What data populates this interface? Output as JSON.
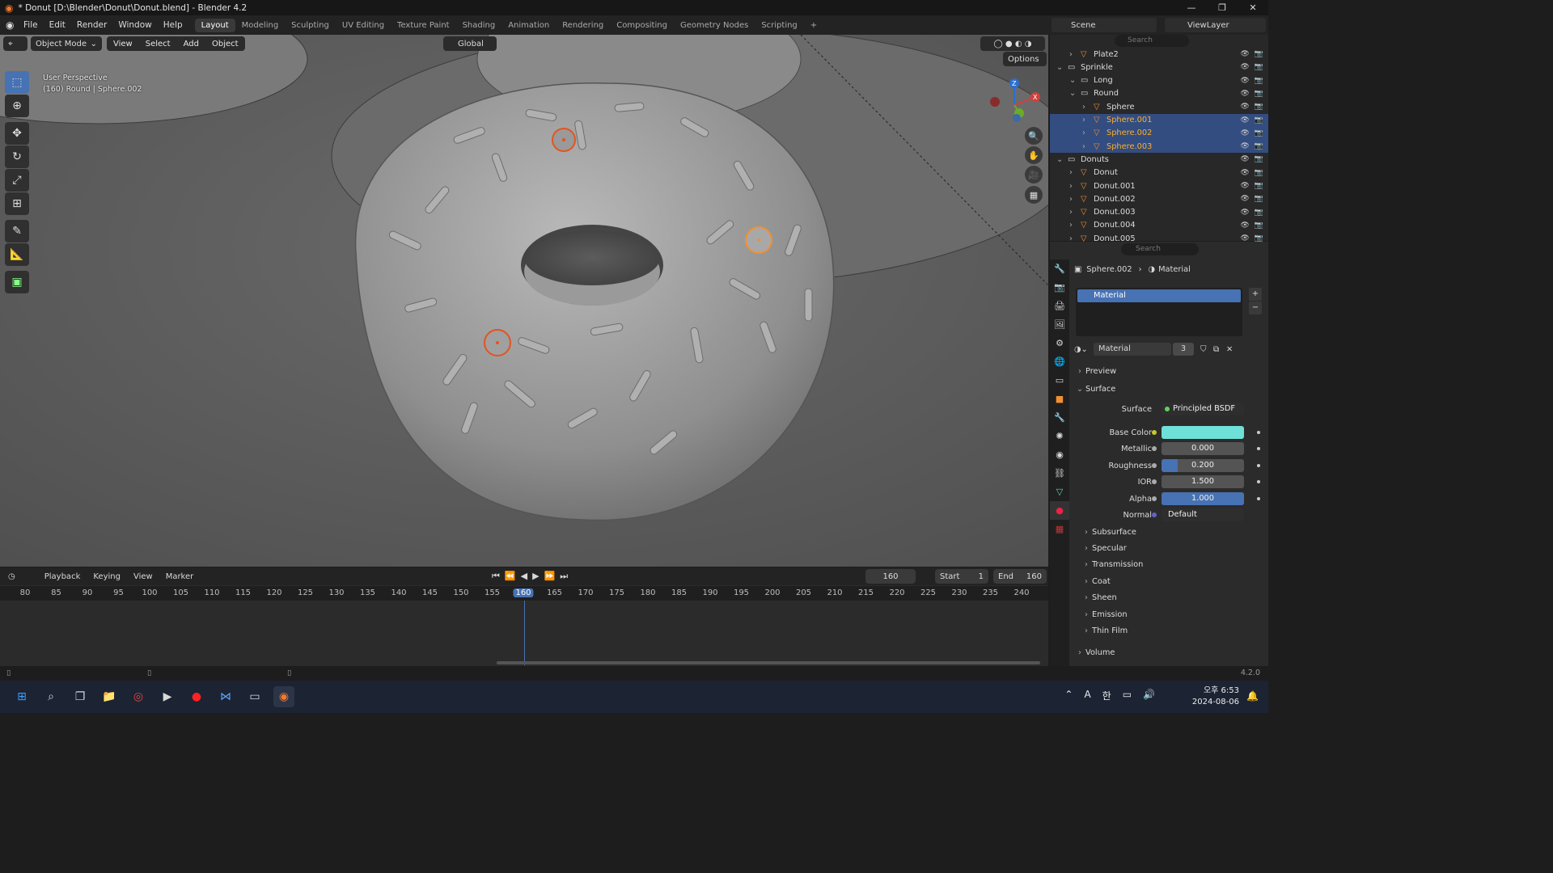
{
  "window": {
    "title": "* Donut [D:\\Blender\\Donut\\Donut.blend] - Blender 4.2"
  },
  "menu": [
    "File",
    "Edit",
    "Render",
    "Window",
    "Help"
  ],
  "workspaces": [
    "Layout",
    "Modeling",
    "Sculpting",
    "UV Editing",
    "Texture Paint",
    "Shading",
    "Animation",
    "Rendering",
    "Compositing",
    "Geometry Nodes",
    "Scripting"
  ],
  "scene": {
    "name": "Scene",
    "view_layer": "ViewLayer"
  },
  "viewport": {
    "mode": "Object Mode",
    "menus": [
      "View",
      "Select",
      "Add",
      "Object"
    ],
    "transform": "Global",
    "options_label": "Options",
    "info_line1": "User Perspective",
    "info_line2": "(160) Round | Sphere.002",
    "gizmo": {
      "x": "X",
      "y": "Y",
      "z": "Z"
    }
  },
  "timeline": {
    "menus": [
      "Playback",
      "Keying",
      "View",
      "Marker"
    ],
    "current_frame": "160",
    "start_label": "Start",
    "start": "1",
    "end_label": "End",
    "end": "160",
    "ticks": [
      "80",
      "85",
      "90",
      "95",
      "100",
      "105",
      "110",
      "115",
      "120",
      "125",
      "130",
      "135",
      "140",
      "145",
      "150",
      "155",
      "160",
      "165",
      "170",
      "175",
      "180",
      "185",
      "190",
      "195",
      "200",
      "205",
      "210",
      "215",
      "220",
      "225",
      "230",
      "235",
      "240"
    ]
  },
  "outliner": {
    "search_placeholder": "Search",
    "rows": [
      {
        "label": "Plate2",
        "indent": 1,
        "type": "object",
        "sel": false
      },
      {
        "label": "Sprinkle",
        "indent": 0,
        "type": "collection",
        "sel": false
      },
      {
        "label": "Long",
        "indent": 1,
        "type": "collection",
        "sel": false
      },
      {
        "label": "Round",
        "indent": 1,
        "type": "collection",
        "sel": false
      },
      {
        "label": "Sphere",
        "indent": 2,
        "type": "object",
        "sel": false
      },
      {
        "label": "Sphere.001",
        "indent": 2,
        "type": "object",
        "sel": true
      },
      {
        "label": "Sphere.002",
        "indent": 2,
        "type": "object",
        "sel": true
      },
      {
        "label": "Sphere.003",
        "indent": 2,
        "type": "object",
        "sel": true
      },
      {
        "label": "Donuts",
        "indent": 0,
        "type": "collection",
        "sel": false
      },
      {
        "label": "Donut",
        "indent": 1,
        "type": "object",
        "sel": false
      },
      {
        "label": "Donut.001",
        "indent": 1,
        "type": "object",
        "sel": false
      },
      {
        "label": "Donut.002",
        "indent": 1,
        "type": "object",
        "sel": false
      },
      {
        "label": "Donut.003",
        "indent": 1,
        "type": "object",
        "sel": false
      },
      {
        "label": "Donut.004",
        "indent": 1,
        "type": "object",
        "sel": false
      },
      {
        "label": "Donut.005",
        "indent": 1,
        "type": "object",
        "sel": false
      }
    ]
  },
  "properties": {
    "search_placeholder": "Search",
    "breadcrumb_object": "Sphere.002",
    "breadcrumb_tab": "Material",
    "slot": "Material",
    "material_name": "Material",
    "users": "3",
    "preview_label": "Preview",
    "surface_label": "Surface",
    "surface_shader_label": "Surface",
    "surface_shader": "Principled BSDF",
    "base_color_label": "Base Color",
    "base_color": "#6ee0d8",
    "metallic_label": "Metallic",
    "metallic": "0.000",
    "metallic_level": 0,
    "roughness_label": "Roughness",
    "roughness": "0.200",
    "roughness_level": 0.2,
    "ior_label": "IOR",
    "ior": "1.500",
    "alpha_label": "Alpha",
    "alpha": "1.000",
    "alpha_level": 1,
    "normal_label": "Normal",
    "normal": "Default",
    "subpanels": [
      "Subsurface",
      "Specular",
      "Transmission",
      "Coat",
      "Sheen",
      "Emission",
      "Thin Film"
    ],
    "volume_label": "Volume"
  },
  "statusbar": {
    "version": "4.2.0"
  },
  "taskbar": {
    "time": "오후 6:53",
    "date": "2024-08-06",
    "ime": "한",
    "lang": "A"
  },
  "colors": {
    "accent": "#4772b3",
    "selected_text": "#ffaf29",
    "selection_highlight": "#334d80"
  }
}
